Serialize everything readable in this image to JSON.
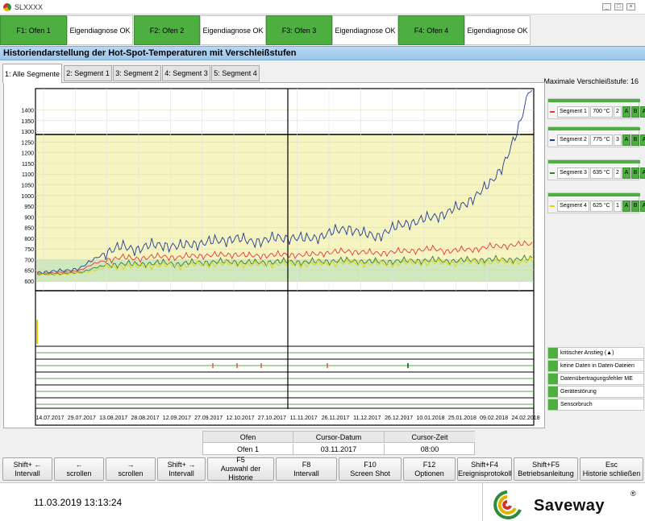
{
  "window": {
    "title": "SLXXXX"
  },
  "ovens": [
    {
      "label": "F1: Ofen 1",
      "status": "Eigendiagnose OK"
    },
    {
      "label": "F2: Ofen 2",
      "status": "Eigendiagnose OK"
    },
    {
      "label": "F3: Ofen 3",
      "status": "Eigendiagnose OK"
    },
    {
      "label": "F4: Ofen 4",
      "status": "Eigendiagnose OK"
    }
  ],
  "heading": "Historiendarstellung der Hot-Spot-Temperaturen mit Verschleißstufen",
  "tabs": [
    "1: Alle Segmente",
    "2: Segment 1",
    "3: Segment 2",
    "4: Segment 3",
    "5: Segment 4"
  ],
  "max_wear_label": "Maximale Verschleißstufe: 16",
  "segments": [
    {
      "name": "Segment 1",
      "temp": "700 °C",
      "level": "2",
      "color": "#e53935"
    },
    {
      "name": "Segment 2",
      "temp": "775 °C",
      "level": "3",
      "color": "#1f3a93"
    },
    {
      "name": "Segment 3",
      "temp": "635 °C",
      "level": "2",
      "color": "#2e7d32"
    },
    {
      "name": "Segment 4",
      "temp": "625 °C",
      "level": "1",
      "color": "#e6d200"
    }
  ],
  "abc": [
    "A",
    "B",
    "A"
  ],
  "events": [
    "kritischer Anstieg (▲)",
    "keine Daten in Daten-Dateien",
    "Datenübertragungsfehler ME",
    "Gerätestörung",
    "Sensorbruch"
  ],
  "cursor_info": {
    "headers": [
      "Ofen",
      "Cursor-Datum",
      "Cursor-Zeit"
    ],
    "values": [
      "Ofen 1",
      "03.11.2017",
      "08:00"
    ]
  },
  "fkeys": [
    {
      "top": "Shift+ ←",
      "bottom": "Intervall"
    },
    {
      "top": "←",
      "bottom": "scrollen"
    },
    {
      "top": "→",
      "bottom": "scrollen"
    },
    {
      "top": "Shift+ →",
      "bottom": "Intervall"
    },
    {
      "top": "F5",
      "bottom": "Auswahl der Historie"
    },
    {
      "top": "F8",
      "bottom": "Intervall"
    },
    {
      "top": "F10",
      "bottom": "Screen Shot"
    },
    {
      "top": "F12",
      "bottom": "Optionen"
    },
    {
      "top": "Shift+F4",
      "bottom": "Ereignisprotokoll"
    },
    {
      "top": "Shift+F5",
      "bottom": "Betriebsanleitung"
    },
    {
      "top": "Esc",
      "bottom": "Historie schließen"
    }
  ],
  "footer": {
    "datetime": "11.03.2019 13:13:24",
    "brand": "Saveway",
    "reg": "®"
  },
  "chart_data": {
    "type": "line",
    "y_ticks": [
      600,
      650,
      700,
      750,
      800,
      850,
      900,
      950,
      1000,
      1050,
      1100,
      1150,
      1200,
      1250,
      1300,
      1350,
      1400
    ],
    "ylim": [
      600,
      1400
    ],
    "x_ticks": [
      "14.07.2017",
      "29.07.2017",
      "13.08.2017",
      "28.08.2017",
      "12.09.2017",
      "27.09.2017",
      "12.10.2017",
      "27.10.2017",
      "11.11.2017",
      "26.11.2017",
      "11.12.2017",
      "26.12.2017",
      "10.01.2018",
      "25.01.2018",
      "09.02.2018",
      "24.02.2018"
    ],
    "cursor_date": "03.11.2017",
    "zones": [
      {
        "from": 600,
        "to": 700,
        "color": "#cfe8bd"
      },
      {
        "from": 700,
        "to": 1400,
        "color": "#f6f4c0"
      },
      {
        "from": 1400,
        "to": 1500,
        "color": "#f7c9c9"
      }
    ],
    "series": [
      {
        "color": "#1f3a93",
        "values": [
          640,
          645,
          648,
          660,
          700,
          740,
          760,
          750,
          765,
          770,
          760,
          775,
          780,
          790,
          800,
          785,
          790,
          800,
          805,
          795,
          810,
          830,
          850,
          820,
          810,
          840,
          870,
          880,
          900,
          920,
          950,
          1000,
          1050,
          1150,
          1300,
          1550
        ]
      },
      {
        "color": "#e53935",
        "values": [
          635,
          638,
          640,
          650,
          680,
          700,
          710,
          705,
          712,
          715,
          710,
          718,
          720,
          722,
          725,
          718,
          720,
          722,
          724,
          720,
          730,
          735,
          740,
          735,
          730,
          735,
          740,
          745,
          750,
          740,
          745,
          750,
          760,
          765,
          770,
          775
        ]
      },
      {
        "color": "#2e7d32",
        "values": [
          630,
          632,
          634,
          640,
          660,
          675,
          680,
          678,
          682,
          685,
          680,
          686,
          688,
          690,
          690,
          686,
          688,
          690,
          690,
          688,
          692,
          694,
          696,
          692,
          690,
          692,
          694,
          696,
          698,
          694,
          696,
          698,
          700,
          700,
          702,
          704
        ]
      },
      {
        "color": "#e6d200",
        "values": [
          628,
          630,
          632,
          636,
          650,
          665,
          670,
          668,
          672,
          674,
          670,
          676,
          678,
          680,
          680,
          676,
          678,
          680,
          680,
          678,
          682,
          684,
          686,
          682,
          680,
          682,
          684,
          686,
          688,
          684,
          686,
          688,
          690,
          690,
          692,
          694
        ]
      }
    ]
  }
}
